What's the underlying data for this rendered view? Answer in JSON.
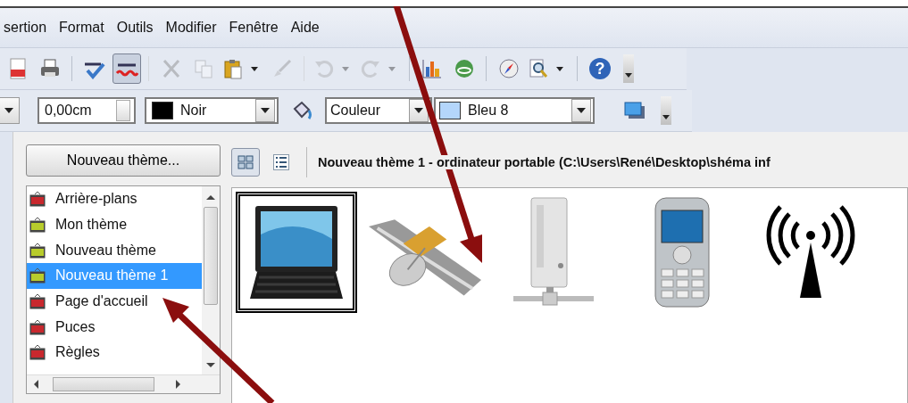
{
  "menu": [
    "sertion",
    "Format",
    "Outils",
    "Modifier",
    "Fenêtre",
    "Aide"
  ],
  "toolbar": [
    {
      "kind": "pdf",
      "disabled": false,
      "pressed": false,
      "group_start": false,
      "menu": false
    },
    {
      "kind": "printer",
      "disabled": false,
      "pressed": false,
      "group_start": false,
      "menu": false
    },
    {
      "kind": "spellcheck",
      "disabled": false,
      "pressed": false,
      "group_start": true,
      "menu": false
    },
    {
      "kind": "autospell",
      "disabled": false,
      "pressed": true,
      "group_start": false,
      "menu": false
    },
    {
      "kind": "cut",
      "disabled": true,
      "pressed": false,
      "group_start": true,
      "menu": false
    },
    {
      "kind": "copy",
      "disabled": true,
      "pressed": false,
      "group_start": false,
      "menu": false
    },
    {
      "kind": "paste",
      "disabled": false,
      "pressed": false,
      "group_start": false,
      "menu": true
    },
    {
      "kind": "brush",
      "disabled": true,
      "pressed": false,
      "group_start": false,
      "menu": false
    },
    {
      "kind": "undo",
      "disabled": true,
      "pressed": false,
      "group_start": true,
      "menu": true
    },
    {
      "kind": "redo",
      "disabled": true,
      "pressed": false,
      "group_start": false,
      "menu": true
    },
    {
      "kind": "chart",
      "disabled": false,
      "pressed": false,
      "group_start": true,
      "menu": false
    },
    {
      "kind": "globe",
      "disabled": false,
      "pressed": false,
      "group_start": false,
      "menu": false
    },
    {
      "kind": "compass",
      "disabled": false,
      "pressed": false,
      "group_start": true,
      "menu": false
    },
    {
      "kind": "zoom",
      "disabled": false,
      "pressed": false,
      "group_start": false,
      "menu": true
    },
    {
      "kind": "help",
      "disabled": false,
      "pressed": false,
      "group_start": true,
      "menu": false,
      "label": "?"
    }
  ],
  "line_toolbar": {
    "width": "0,00cm",
    "line_color": {
      "label": "Noir",
      "color": "#000000"
    },
    "fill_type": "Couleur",
    "fill_color": {
      "label": "Bleu 8",
      "color": "#b4d6fb"
    }
  },
  "gallery": {
    "new_theme_button": "Nouveau thème...",
    "themes": [
      {
        "label": "Arrière-plans",
        "color": "#c8282e",
        "selected": false
      },
      {
        "label": "Mon thème",
        "color": "#b8cc2c",
        "selected": false
      },
      {
        "label": "Nouveau thème",
        "color": "#b8cc2c",
        "selected": false
      },
      {
        "label": "Nouveau thème 1",
        "color": "#b8cc2c",
        "selected": true
      },
      {
        "label": "Page d'accueil",
        "color": "#c8282e",
        "selected": false
      },
      {
        "label": "Puces",
        "color": "#c8282e",
        "selected": false
      },
      {
        "label": "Règles",
        "color": "#c8282e",
        "selected": false
      }
    ],
    "view_buttons": [
      {
        "kind": "icons",
        "selected": true
      },
      {
        "kind": "details",
        "selected": false
      }
    ],
    "title": "Nouveau thème 1 - ordinateur portable (C:\\Users\\René\\Desktop\\shéma inf",
    "items": [
      {
        "kind": "laptop",
        "selected": true
      },
      {
        "kind": "satellite",
        "selected": false
      },
      {
        "kind": "server",
        "selected": false
      },
      {
        "kind": "phone",
        "selected": false
      },
      {
        "kind": "antenna",
        "selected": false
      }
    ]
  }
}
